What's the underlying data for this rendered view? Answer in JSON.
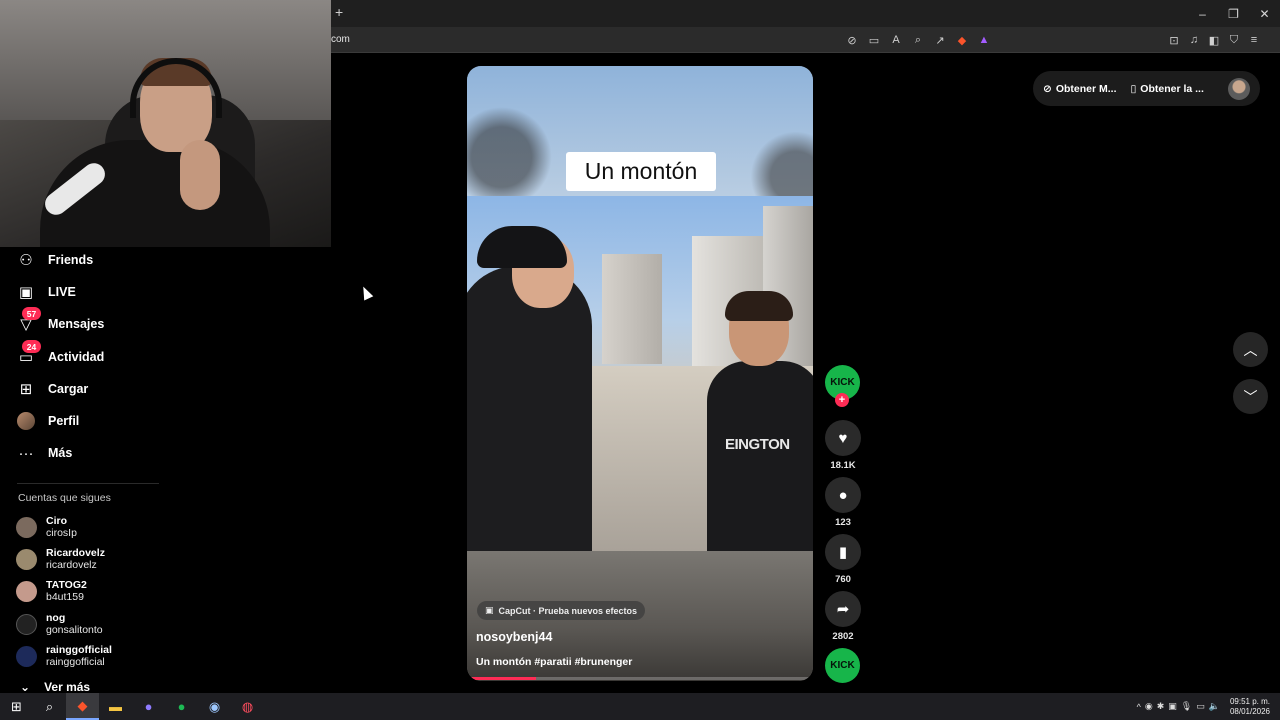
{
  "browser": {
    "new_tab": "+",
    "url": "com",
    "window_controls": [
      "–",
      "❐",
      "✕"
    ]
  },
  "sidebar": {
    "nav": [
      {
        "label": "Friends",
        "icon": "friends-icon",
        "glyph": "👥"
      },
      {
        "label": "LIVE",
        "icon": "live-icon",
        "glyph": "📺"
      },
      {
        "label": "Mensajes",
        "icon": "messages-icon",
        "glyph": "▽",
        "badge": "57"
      },
      {
        "label": "Actividad",
        "icon": "activity-icon",
        "glyph": "💬",
        "badge": "24"
      },
      {
        "label": "Cargar",
        "icon": "upload-icon",
        "glyph": "⊞"
      },
      {
        "label": "Perfil",
        "icon": "profile-avatar",
        "glyph": ""
      },
      {
        "label": "Más",
        "icon": "more-icon",
        "glyph": "···"
      }
    ],
    "following_title": "Cuentas que sigues",
    "following": [
      {
        "name": "Ciro",
        "handle": "cirosIp",
        "color": "#7b6a5e"
      },
      {
        "name": "Ricardovelz",
        "handle": "ricardovelz",
        "color": "#9a8a6e"
      },
      {
        "name": "TATOG2",
        "handle": "b4ut159",
        "color": "#c49a8c"
      },
      {
        "name": "nog",
        "handle": "gonsalitonto",
        "color": "#222222"
      },
      {
        "name": "rainggofficial",
        "handle": "rainggofficial",
        "color": "#1d2a5a"
      }
    ],
    "see_more": "Ver más"
  },
  "video": {
    "caption": "Un montón",
    "shirt_text": "EINGTON",
    "capcut_label": "CapCut · Prueba nuevos efectos",
    "author": "nosoybenj44",
    "description": "Un montón #paratii #brunenger",
    "progress": 0.2
  },
  "actions": {
    "creator_label": "KICK",
    "follow_plus": "+",
    "likes": "18.1K",
    "comments": "123",
    "saves": "760",
    "shares": "2802",
    "sound_label": "KICK"
  },
  "topright": {
    "btn1": "Obtener M...",
    "btn2": "Obtener la ..."
  },
  "taskbar": {
    "time": "09:51 p. m.",
    "date": "08/01/2026"
  }
}
